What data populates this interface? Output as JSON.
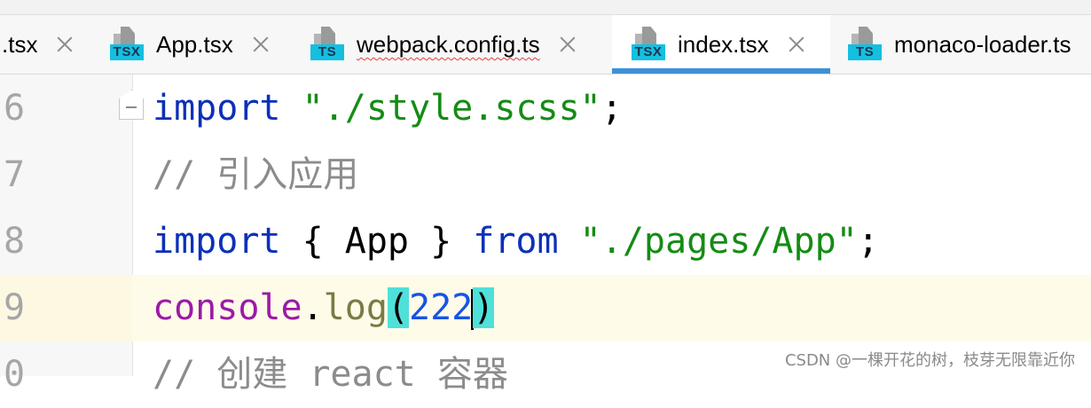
{
  "tabs": [
    {
      "label": ".tsx",
      "icon": "tsx-file-icon",
      "icon_tag": "",
      "active": false
    },
    {
      "label": "App.tsx",
      "icon": "tsx-file-icon",
      "icon_tag": "TSX",
      "active": false
    },
    {
      "label": "webpack.config.ts",
      "icon": "ts-file-icon",
      "icon_tag": "TS",
      "active": false,
      "has_error_underline": true
    },
    {
      "label": "index.tsx",
      "icon": "tsx-file-icon",
      "icon_tag": "TSX",
      "active": true
    },
    {
      "label": "monaco-loader.ts",
      "icon": "ts-file-icon",
      "icon_tag": "TS",
      "active": false
    }
  ],
  "editor": {
    "current_line": 9,
    "lines": [
      {
        "number": "6",
        "tokens": [
          "import",
          " ",
          "\"./style.scss\"",
          ";"
        ]
      },
      {
        "number": "7",
        "tokens": [
          "// 引入应用"
        ]
      },
      {
        "number": "8",
        "tokens": [
          "import",
          " { App } ",
          "from",
          " ",
          "\"./pages/App\"",
          ";"
        ]
      },
      {
        "number": "9",
        "tokens": [
          "console",
          ".",
          "log",
          "(",
          "222",
          ")"
        ]
      },
      {
        "number": "0",
        "tokens": [
          "// 创建 react 容器"
        ]
      }
    ]
  },
  "colors": {
    "keyword": "#0c30b8",
    "string": "#148c14",
    "comment": "#8c8c8c",
    "global_object": "#9b1aa8",
    "function": "#7a7a44",
    "number": "#1753e8",
    "brace_match": "#4fe0da",
    "active_tab_underline": "#3d91d8"
  },
  "watermark": "CSDN @一棵开花的树，枝芽无限靠近你"
}
